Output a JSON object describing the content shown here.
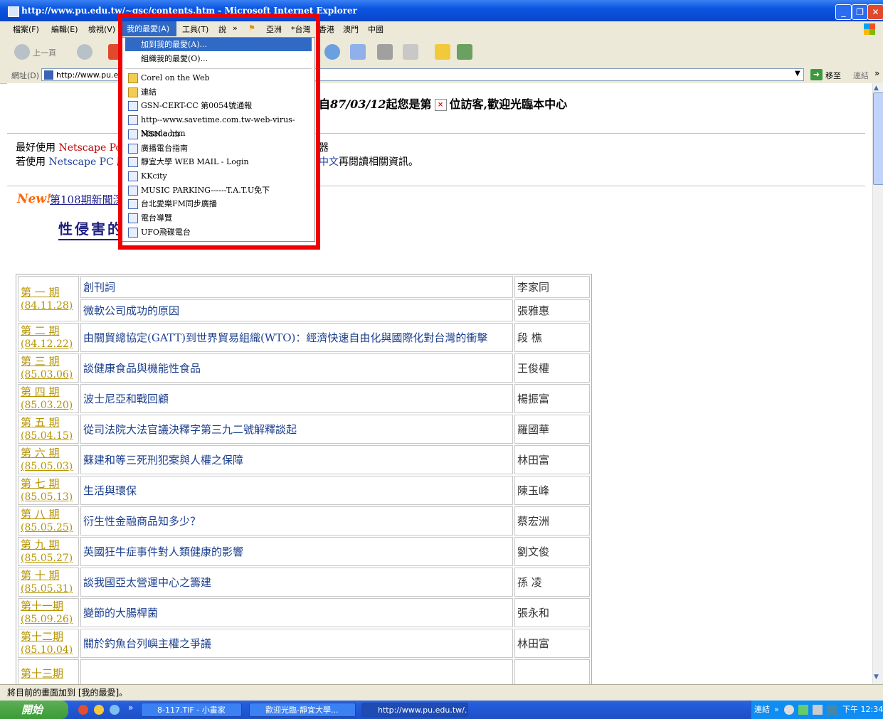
{
  "window": {
    "title": "http://www.pu.edu.tw/~gsc/contents.htm - Microsoft Internet Explorer"
  },
  "menubar": {
    "items": [
      "檔案(F)",
      "編輯(E)",
      "檢視(V)",
      "我的最愛(A)",
      "工具(T)",
      "說",
      "»",
      "亞洲",
      "*台灣",
      "香港",
      "澳門",
      "中國"
    ]
  },
  "toolbar": {
    "back_label": "上一頁"
  },
  "addressbar": {
    "label": "網址(D)",
    "value": "http://www.pu.edu",
    "go_label": "移至",
    "links_label": "連結",
    "chevron": "»"
  },
  "favorites_menu": {
    "add": "加到我的最愛(A)...",
    "organize": "組織我的最愛(O)...",
    "items": [
      {
        "label": "Corel on the Web",
        "icon": "folder-icon"
      },
      {
        "label": "連結",
        "icon": "folder-icon"
      },
      {
        "label": "GSN-CERT-CC 第0054號通報",
        "icon": "page-icon"
      },
      {
        "label": "http--www.savetime.com.tw-web-virus-Nimda.htm",
        "icon": "page-icon"
      },
      {
        "label": "MSN.com",
        "icon": "page-icon"
      },
      {
        "label": "廣播電台指南",
        "icon": "page-icon"
      },
      {
        "label": "靜宜大學 WEB MAIL - Login",
        "icon": "page-icon"
      },
      {
        "label": "KKcity",
        "icon": "page-icon"
      },
      {
        "label": "MUSIC PARKING------T.A.T.U免下",
        "icon": "page-icon"
      },
      {
        "label": "台北愛樂FM同步廣播",
        "icon": "page-icon"
      },
      {
        "label": "電台導覽",
        "icon": "page-icon"
      },
      {
        "label": "UFO飛碟電台",
        "icon": "page-icon"
      }
    ]
  },
  "page": {
    "visitor_prefix": "自",
    "visitor_date": "87/03/12",
    "visitor_mid": "起您是第",
    "visitor_suffix": "位訪客,歡迎光臨本中心",
    "line1_a": "最好使用",
    "line1_b": "Netscape Pow",
    "line1_c": "器",
    "line2_a": "若使用",
    "line2_b": "Netscape PC",
    "line2_c": "版",
    "line2_d": "中文",
    "line2_e": "再閱讀相關資訊。",
    "new_badge": "New!",
    "news_link": "第108期新聞深",
    "big_title": "性侵害的"
  },
  "issues": [
    {
      "period": "第 一 期",
      "date": "(84.11.28)",
      "titles": [
        "創刊詞",
        "微軟公司成功的原因"
      ],
      "authors": [
        "李家同",
        "張雅惠"
      ]
    },
    {
      "period": "第 二 期",
      "date": "(84.12.22)",
      "titles": [
        "由關貿總協定(GATT)到世界貿易組織(WTO)：經濟快速自由化與國際化對台灣的衝擊"
      ],
      "authors": [
        "段 樵"
      ]
    },
    {
      "period": "第 三 期",
      "date": "(85.03.06)",
      "titles": [
        "談健康食品與機能性食品"
      ],
      "authors": [
        "王俊權"
      ]
    },
    {
      "period": "第 四 期",
      "date": "(85.03.20)",
      "titles": [
        "波士尼亞和戰回顧"
      ],
      "authors": [
        "楊振富"
      ]
    },
    {
      "period": "第 五 期",
      "date": "(85.04.15)",
      "titles": [
        "從司法院大法官議決釋字第三九二號解釋談起"
      ],
      "authors": [
        "羅國華"
      ]
    },
    {
      "period": "第 六 期",
      "date": "(85.05.03)",
      "titles": [
        "蘇建和等三死刑犯案與人權之保障"
      ],
      "authors": [
        "林田富"
      ]
    },
    {
      "period": "第 七 期",
      "date": "(85.05.13)",
      "titles": [
        "生活與環保"
      ],
      "authors": [
        "陳玉峰"
      ]
    },
    {
      "period": "第 八 期",
      "date": "(85.05.25)",
      "titles": [
        "衍生性金融商品知多少？"
      ],
      "authors": [
        "蔡宏洲"
      ]
    },
    {
      "period": "第 九 期",
      "date": "(85.05.27)",
      "titles": [
        "英國狂牛症事件對人類健康的影響"
      ],
      "authors": [
        "劉文俊"
      ]
    },
    {
      "period": "第 十 期",
      "date": "(85.05.31)",
      "titles": [
        "談我國亞太營運中心之籌建"
      ],
      "authors": [
        "孫 凌"
      ]
    },
    {
      "period": "第十一期",
      "date": "(85.09.26)",
      "titles": [
        "變節的大腸桿菌"
      ],
      "authors": [
        "張永和"
      ]
    },
    {
      "period": "第十二期",
      "date": "(85.10.04)",
      "titles": [
        "關於釣魚台列嶼主權之爭議"
      ],
      "authors": [
        "林田富"
      ]
    },
    {
      "period": "第十三期",
      "date": "",
      "titles": [
        ""
      ],
      "authors": [
        ""
      ]
    }
  ],
  "statusbar": {
    "text": "將目前的畫面加到 [我的最愛]。"
  },
  "taskbar": {
    "start": "開始",
    "chevron": "»",
    "tasks": [
      "8-117.TIF - 小畫家",
      "歡迎光臨-靜宜大學...",
      "http://www.pu.edu.tw/..."
    ],
    "tray_links": "連結",
    "clock": "下午 12:34"
  },
  "colors": {
    "accent": "#316ac5",
    "highlight_frame": "#f00000",
    "title_blue": "#0a55e0"
  }
}
